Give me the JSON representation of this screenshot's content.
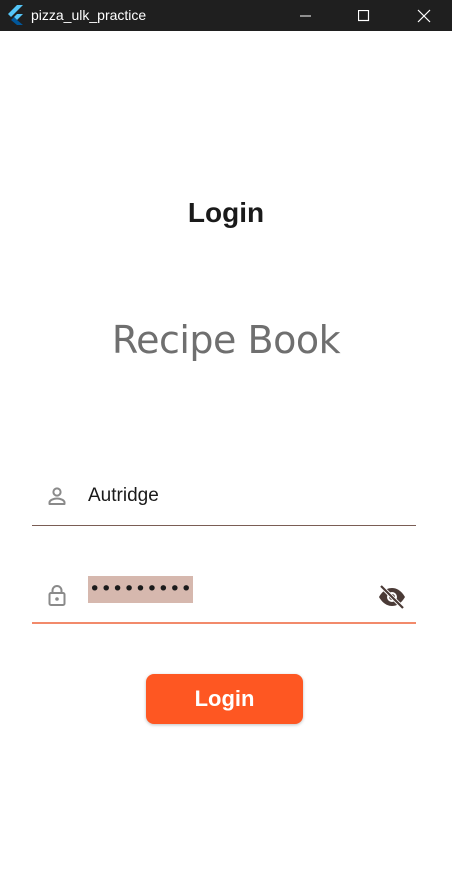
{
  "window": {
    "title": "pizza_ulk_practice",
    "icon": "flutter-logo-icon",
    "controls": [
      "minimize-icon",
      "maximize-icon",
      "close-icon"
    ]
  },
  "page": {
    "title": "Login",
    "app_name": "Recipe Book"
  },
  "form": {
    "username": {
      "icon": "person-icon",
      "value": "Autridge"
    },
    "password": {
      "icon": "lock-icon",
      "value": "•••••••••",
      "visibility_icon": "visibility-off-icon",
      "selected": true
    },
    "submit_label": "Login"
  },
  "colors": {
    "titlebar": "#1f1f1f",
    "accent": "#fe5722",
    "underline_focused": "#f28a6b",
    "underline_default": "#7a5d55",
    "selection": "#d6b8ae",
    "icon": "#8a8a8a"
  }
}
